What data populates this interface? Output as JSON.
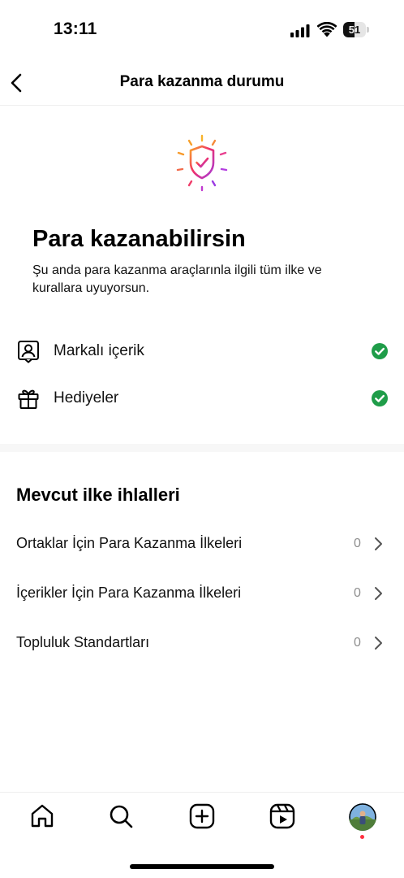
{
  "status_bar": {
    "time": "13:11",
    "battery": "51",
    "battery_level": 0.51
  },
  "header": {
    "title": "Para kazanma durumu",
    "back_icon": "chevron-left-icon"
  },
  "hero": {
    "icon": "shield-check-icon",
    "title": "Para kazanabilirsin",
    "subtitle": "Şu anda para kazanma araçlarınla ilgili tüm ilke ve kurallara uyuyorsun."
  },
  "eligibility": [
    {
      "label": "Markalı içerik",
      "icon": "branded-content-icon",
      "status": "eligible"
    },
    {
      "label": "Hediyeler",
      "icon": "gift-icon",
      "status": "eligible"
    }
  ],
  "violations": {
    "title": "Mevcut ilke ihlalleri",
    "items": [
      {
        "label": "Ortaklar İçin Para Kazanma İlkeleri",
        "count": "0"
      },
      {
        "label": "İçerikler İçin Para Kazanma İlkeleri",
        "count": "0"
      },
      {
        "label": "Topluluk Standartları",
        "count": "0"
      }
    ]
  },
  "bottom_nav": {
    "items": [
      "home-icon",
      "search-icon",
      "create-icon",
      "reels-icon",
      "profile-avatar"
    ]
  },
  "colors": {
    "check_green": "#1f9d49",
    "notification_red": "#ff3040",
    "muted_text": "#8e8e8e"
  }
}
